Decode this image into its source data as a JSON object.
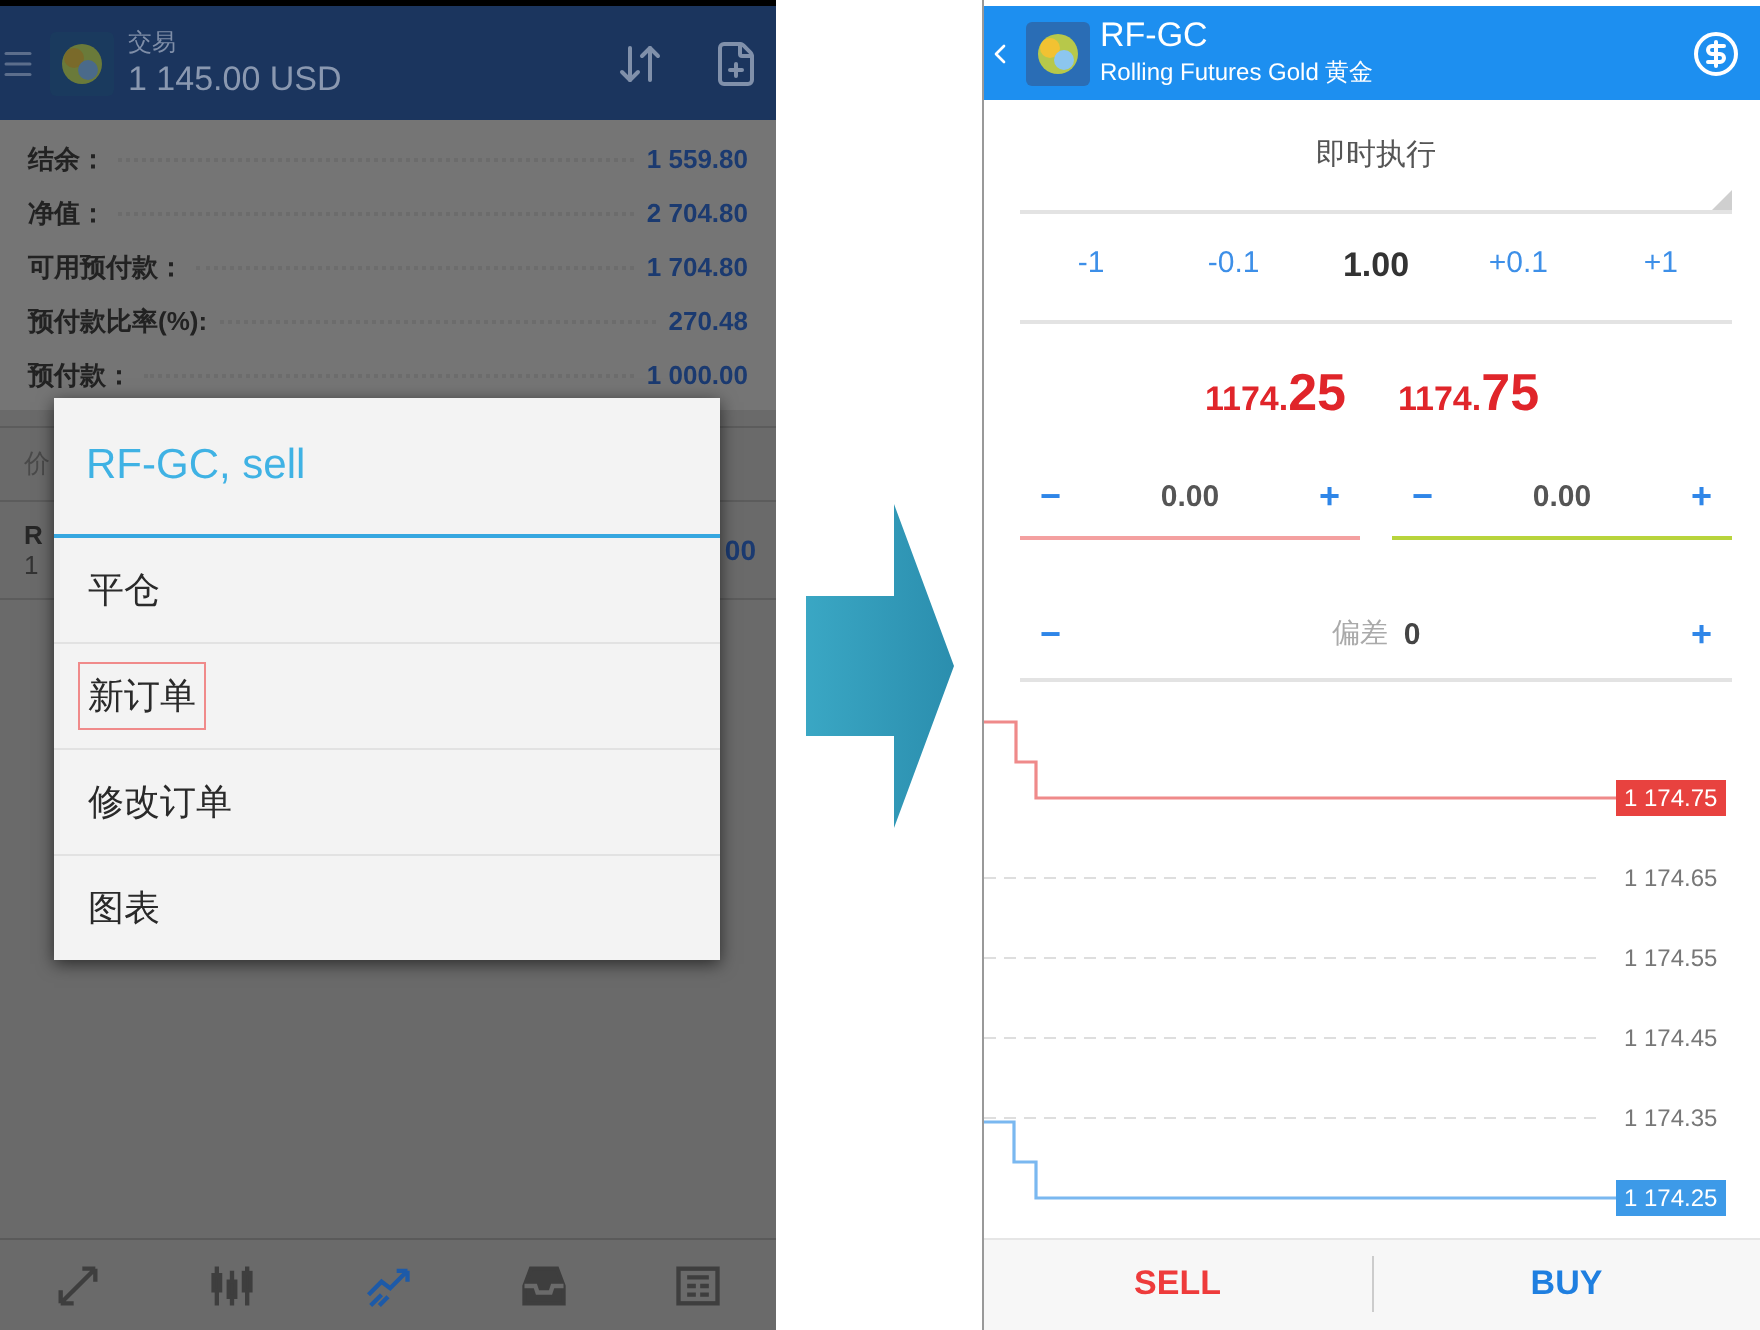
{
  "left_screen": {
    "header": {
      "title": "交易",
      "balance": "1 145.00 USD"
    },
    "account": [
      {
        "label": "结余：",
        "value": "1 559.80"
      },
      {
        "label": "净值：",
        "value": "2 704.80"
      },
      {
        "label": "可用预付款：",
        "value": "1 704.80"
      },
      {
        "label": "预付款比率(%):",
        "value": "270.48"
      },
      {
        "label": "预付款：",
        "value": "1 000.00"
      }
    ],
    "section_header": "价",
    "position": {
      "symbol": "R",
      "line_2": "1",
      "value": "00"
    },
    "dialog": {
      "title": "RF-GC, sell",
      "items": [
        {
          "label": "平仓",
          "highlighted": false
        },
        {
          "label": "新订单",
          "highlighted": true
        },
        {
          "label": "修改订单",
          "highlighted": false
        },
        {
          "label": "图表",
          "highlighted": false
        }
      ]
    },
    "nav": [
      {
        "kind": "trade",
        "selected": false
      },
      {
        "kind": "quotes",
        "selected": false
      },
      {
        "kind": "chart",
        "selected": true
      },
      {
        "kind": "mailbox",
        "selected": false
      },
      {
        "kind": "news",
        "selected": false
      }
    ]
  },
  "right_screen": {
    "header": {
      "symbol": "RF-GC",
      "description": "Rolling Futures Gold 黄金"
    },
    "order_type": "即时执行",
    "volume": [
      {
        "label": "-1",
        "kind": "step"
      },
      {
        "label": "-0.1",
        "kind": "step"
      },
      {
        "label": "1.00",
        "kind": "value"
      },
      {
        "label": "+0.1",
        "kind": "step"
      },
      {
        "label": "+1",
        "kind": "step"
      }
    ],
    "prices": [
      {
        "main": "1174.",
        "pips": "25"
      },
      {
        "main": "1174.",
        "pips": "75"
      }
    ],
    "stops": [
      {
        "minus": "−",
        "value": "0.00",
        "plus": "+",
        "color": "#f4a0a0"
      },
      {
        "minus": "−",
        "value": "0.00",
        "plus": "+",
        "color": "#b8d43c"
      }
    ],
    "deviation": {
      "minus": "−",
      "label": "偏差",
      "value": "0",
      "plus": "+"
    },
    "price_axis": [
      {
        "label": "1 174.75",
        "kind": "ask"
      },
      {
        "label": "1 174.65",
        "kind": "grid"
      },
      {
        "label": "1 174.55",
        "kind": "grid"
      },
      {
        "label": "1 174.45",
        "kind": "grid"
      },
      {
        "label": "1 174.35",
        "kind": "grid"
      },
      {
        "label": "1 174.25",
        "kind": "bid"
      }
    ],
    "actions": [
      {
        "label": "SELL",
        "kind": "sell"
      },
      {
        "label": "BUY",
        "kind": "buy"
      }
    ]
  }
}
